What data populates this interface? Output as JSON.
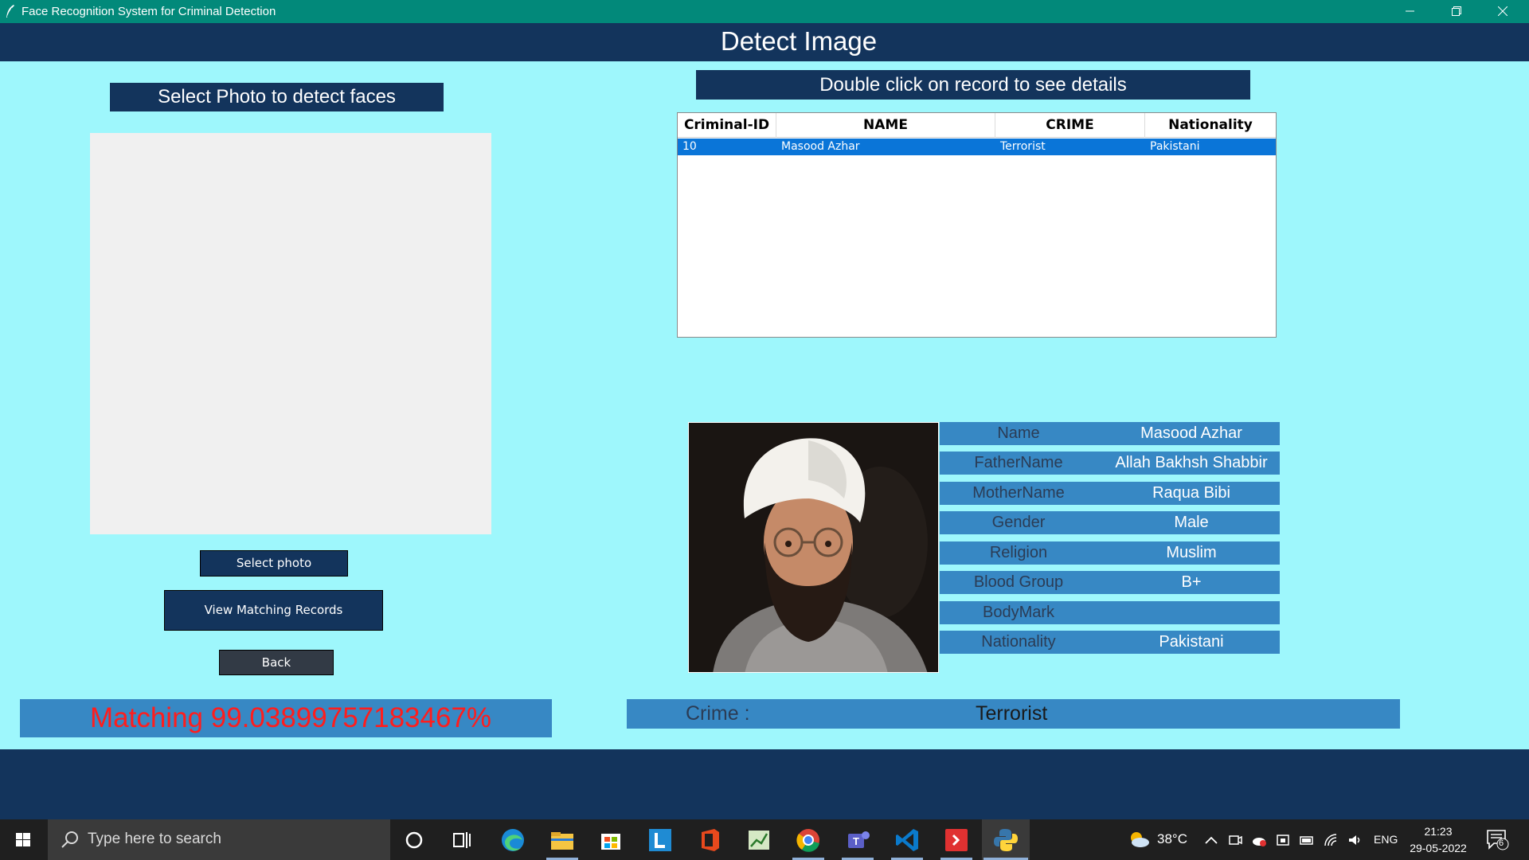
{
  "window": {
    "title": "Face Recognition System for Criminal Detection"
  },
  "header": {
    "title": "Detect Image"
  },
  "left_panel": {
    "select_label": "Select Photo to detect faces",
    "select_photo_button": "Select photo",
    "view_matching_button": "View Matching Records",
    "back_button": "Back",
    "matching_text": "Matching 99.03899757183467%"
  },
  "right_panel": {
    "instruction": "Double click on record to see details",
    "table": {
      "columns": [
        "Criminal-ID",
        "NAME",
        "CRIME",
        "Nationality"
      ],
      "rows": [
        {
          "id": "10",
          "name": "Masood Azhar",
          "crime": "Terrorist",
          "nationality": "Pakistani",
          "selected": true
        }
      ]
    },
    "details": [
      {
        "key": "Name",
        "value": "Masood Azhar"
      },
      {
        "key": "FatherName",
        "value": "Allah Bakhsh Shabbir"
      },
      {
        "key": "MotherName",
        "value": "Raqua Bibi"
      },
      {
        "key": "Gender",
        "value": "Male"
      },
      {
        "key": "Religion",
        "value": "Muslim"
      },
      {
        "key": "Blood Group",
        "value": "B+"
      },
      {
        "key": "BodyMark",
        "value": ""
      },
      {
        "key": "Nationality",
        "value": "Pakistani"
      }
    ],
    "crime_label": "Crime :",
    "crime_value": "Terrorist"
  },
  "taskbar": {
    "search_placeholder": "Type here to search",
    "weather": "38°C",
    "language": "ENG",
    "time": "21:23",
    "date": "29-05-2022",
    "notification_count": "6",
    "icons": [
      "cortana-icon",
      "task-view-icon",
      "edge-icon",
      "file-explorer-icon",
      "store-icon",
      "app-l-icon",
      "office-icon",
      "chart-app-icon",
      "chrome-icon",
      "teams-icon",
      "vscode-icon",
      "git-icon",
      "python-icon"
    ]
  },
  "colors": {
    "background": "#9ef7fc",
    "navy": "#13345c",
    "title_bar": "#02897a",
    "field_blue": "#3788c4",
    "selection": "#0a75d8",
    "matching_red": "#ff1d1d"
  }
}
